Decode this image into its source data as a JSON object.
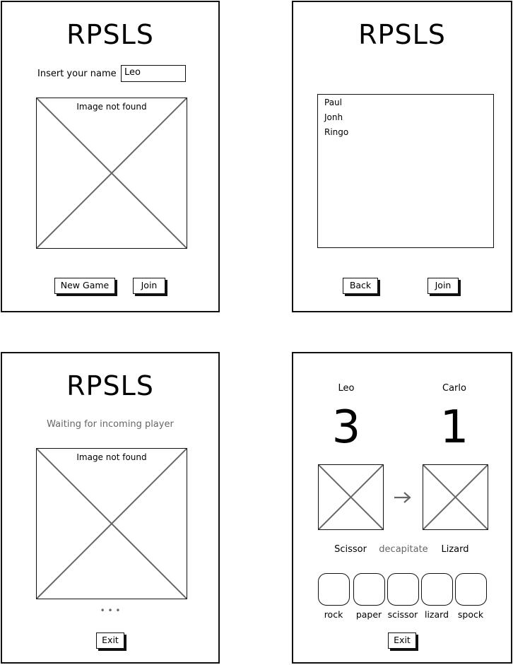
{
  "app_title": "RPSLS",
  "screen1": {
    "name_label": "Insert your name",
    "name_value": "Leo",
    "image_caption": "Image not found",
    "new_game_label": "New Game",
    "join_label": "Join"
  },
  "screen2": {
    "players": [
      "Paul",
      "Jonh",
      "Ringo"
    ],
    "back_label": "Back",
    "join_label": "Join"
  },
  "screen3": {
    "status": "Waiting for incoming player",
    "image_caption": "Image not found",
    "loading": "• • •",
    "exit_label": "Exit"
  },
  "screen4": {
    "player1": "Leo",
    "player2": "Carlo",
    "score1": "3",
    "score2": "1",
    "move1": "Scissor",
    "verb": "decapitate",
    "move2": "Lizard",
    "choices": [
      "rock",
      "paper",
      "scissor",
      "lizard",
      "spock"
    ],
    "exit_label": "Exit"
  }
}
